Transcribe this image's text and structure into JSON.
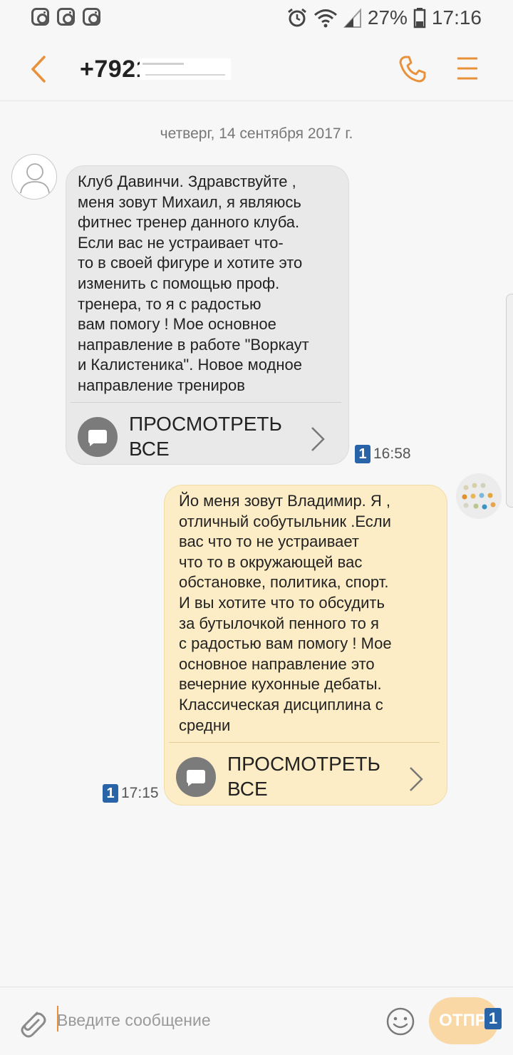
{
  "status_bar": {
    "icons": [
      "instagram-icon",
      "instagram-icon",
      "instagram-icon",
      "alarm-icon",
      "wifi-icon",
      "signal-icon",
      "battery-icon"
    ],
    "battery": "27%",
    "time": "17:16"
  },
  "header": {
    "title": "+7921"
  },
  "conversation": {
    "date": "четверг, 14 сентября 2017 г.",
    "messages": [
      {
        "direction": "incoming",
        "text": "Клуб Давинчи. Здравствуйте ,\nменя зовут Михаил, я являюсь\nфитнес тренер данного клуба.\nЕсли вас не устраивает что-\nто в своей фигуре и хотите это\nизменить с помощью проф.\nтренера, то я с радостью\nвам помогу ! Мое основное\nнаправление в работе \"Воркаут\nи Калистеника\". Новое модное\nнаправление трениров",
        "view_all": "ПРОСМОТРЕТЬ ВСЕ",
        "sim": "1",
        "time": "16:58"
      },
      {
        "direction": "outgoing",
        "text": "Йо меня зовут Владимир. Я ,\nотличный собутыльник .Если\nвас что то не устраивает\nчто то в окружающей вас\nобстановке, политика, спорт.\nИ вы хотите что то обсудить\nза бутылочкой пенного то я\nс  радостью вам помогу ! Мое\nосновное направление это\nвечерние кухонные дебаты.\nКлассическая дисциплина с\nсредни",
        "view_all": "ПРОСМОТРЕТЬ ВСЕ",
        "sim": "1",
        "time": "17:15"
      }
    ]
  },
  "composer": {
    "placeholder": "Введите сообщение",
    "send_label": "ОТПР.",
    "sim": "1"
  },
  "colors": {
    "accent": "#e8913a",
    "incoming_bubble": "#e9e9e9",
    "outgoing_bubble": "#fdedc6",
    "sim_badge": "#2a64a8"
  }
}
